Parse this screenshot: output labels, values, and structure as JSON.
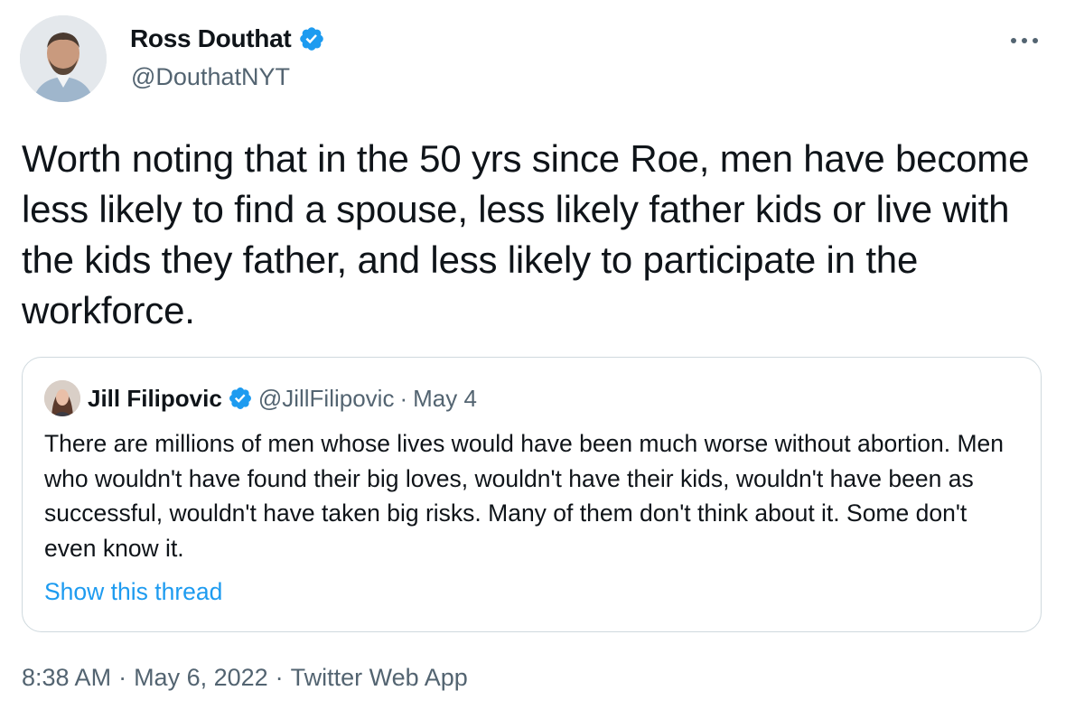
{
  "author": {
    "display_name": "Ross Douthat",
    "handle": "@DouthatNYT",
    "verified": true
  },
  "tweet": {
    "text": "Worth noting that in the 50 yrs since Roe, men have become less likely to find a spouse, less likely father kids or live with the kids they father, and less likely to participate in the workforce."
  },
  "quoted_tweet": {
    "display_name": "Jill Filipovic",
    "handle": "@JillFilipovic",
    "separator": "·",
    "date": "May 4",
    "text": "There are millions of men whose lives would have been much worse without abortion. Men who wouldn't have found their big loves, wouldn't have their kids, wouldn't have been as successful, wouldn't have taken big risks. Many of them don't think about it. Some don't even know it.",
    "show_thread_label": "Show this thread"
  },
  "meta": {
    "time": "8:38 AM",
    "separator": "·",
    "date": "May 6, 2022",
    "source": "Twitter Web App"
  },
  "icons": {
    "verified": "verified-badge-icon",
    "more": "more-options-icon"
  },
  "colors": {
    "accent": "#1d9bf0",
    "secondary_text": "#536471",
    "border": "#cfd9de"
  }
}
